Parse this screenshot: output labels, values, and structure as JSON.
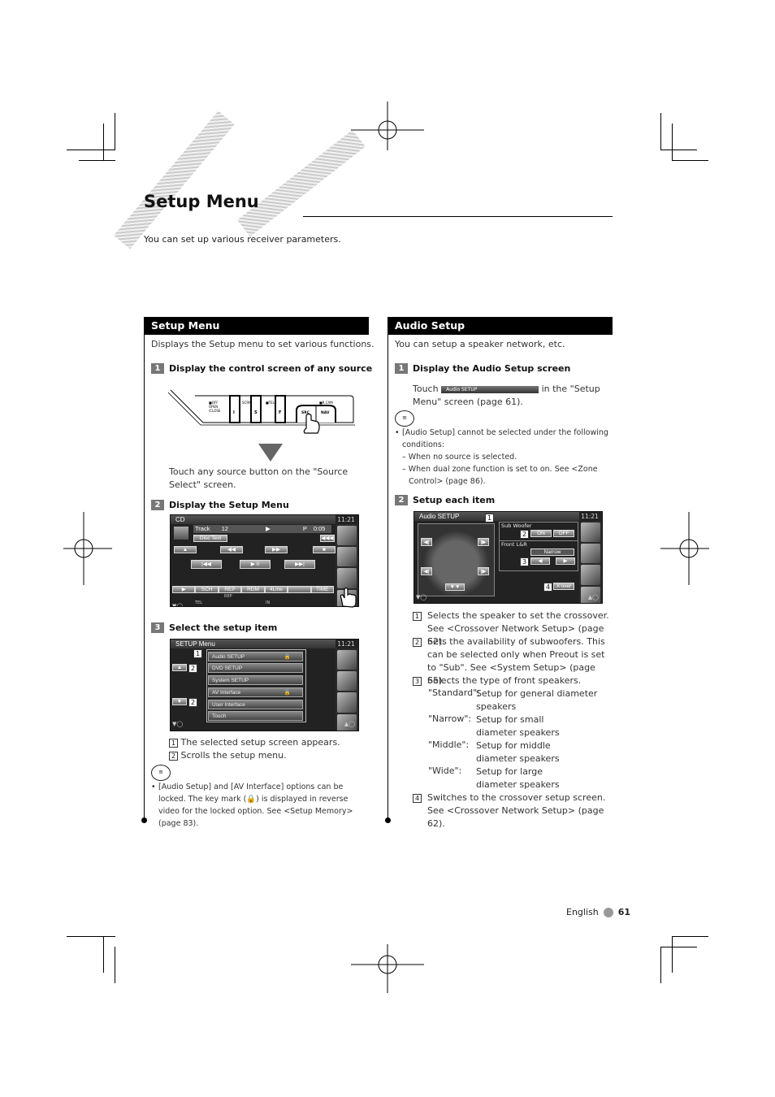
{
  "page": {
    "title": "Setup Menu",
    "intro": "You can set up various receiver parameters.",
    "footer": {
      "language": "English",
      "page_number": "61"
    }
  },
  "left": {
    "heading": "Setup Menu",
    "description": "Displays the Setup menu to set various functions.",
    "steps": [
      {
        "num": "1",
        "label": "Display the control screen of any source",
        "text": "Touch any source button on the \"Source Select\" screen.",
        "panel_labels": {
          "off": "■OFF",
          "open": "OPEN",
          "close": "/CLOSE",
          "scrn": "SCRN",
          "tel": "■TEL",
          "rcam": "■R.CAM",
          "btn1": "I",
          "btn2": "S",
          "btn3": "F",
          "src": "SRC",
          "nav": "NAV"
        }
      },
      {
        "num": "2",
        "label": "Display the Setup Menu",
        "screen": {
          "source": "CD",
          "clock": "11:21",
          "track_label": "Track",
          "track": "12",
          "mode": "P",
          "time": "0:05",
          "disc_text": "Disc Text",
          "bottom_buttons": [
            "▶",
            "SCH",
            "REP",
            "RDM",
            "4Line",
            "",
            "TIME"
          ],
          "status": [
            "TEL",
            "REP",
            "IN"
          ]
        }
      },
      {
        "num": "3",
        "label": "Select the setup item",
        "screen": {
          "header": "SETUP Menu",
          "clock": "11:21",
          "items": [
            "Audio SETUP",
            "DVD SETUP",
            "System SETUP",
            "AV Interface",
            "User Interface",
            "Touch"
          ],
          "locked_items": [
            "Audio SETUP",
            "AV Interface"
          ]
        }
      }
    ],
    "callouts": [
      {
        "num": "1",
        "text": "The selected setup screen appears."
      },
      {
        "num": "2",
        "text": "Scrolls the setup menu."
      }
    ],
    "note": "[Audio Setup]  and [AV Interface] options can be locked. The key mark (🔒) is displayed in reverse video for the locked option. See <Setup Memory> (page 83)."
  },
  "right": {
    "heading": "Audio Setup",
    "description": "You can setup a speaker network, etc.",
    "step1": {
      "num": "1",
      "label": "Display the Audio Setup screen",
      "touch": "Touch",
      "button": "Audio SETUP",
      "after": "in the \"Setup Menu\" screen (page 61)."
    },
    "note_intro": "[Audio Setup] cannot be selected under the following conditions:",
    "note_items": [
      "– When no source is selected.",
      "– When dual zone function is set to on. See <Zone Control> (page 86)."
    ],
    "step2": {
      "num": "2",
      "label": "Setup each item",
      "screen": {
        "header": "Audio SETUP",
        "clock": "11:21",
        "sub_woofer": "Sub Woofer",
        "on": "ON",
        "off": "OFF",
        "front": "Front L&R",
        "front_value": "Narrow",
        "xover": "X'over"
      }
    },
    "callouts": [
      {
        "num": "1",
        "text": "Selects the speaker to set the crossover. See <Crossover Network Setup> (page 62)."
      },
      {
        "num": "2",
        "text": "Sets the availability of subwoofers. This can be selected only when Preout is set to \"Sub\". See <System Setup> (page 65)."
      },
      {
        "num": "3",
        "text": "Selects the type of front speakers."
      },
      {
        "num": "4",
        "text": "Switches to the crossover setup screen. See <Crossover Network Setup> (page 62)."
      }
    ],
    "speaker_types": [
      {
        "term": "\"Standard\":",
        "def": "Setup for general diameter speakers"
      },
      {
        "term": "\"Narrow\":",
        "def": "Setup for small diameter speakers"
      },
      {
        "term": "\"Middle\":",
        "def": "Setup for middle diameter speakers"
      },
      {
        "term": "\"Wide\":",
        "def": "Setup for large diameter speakers"
      }
    ]
  }
}
